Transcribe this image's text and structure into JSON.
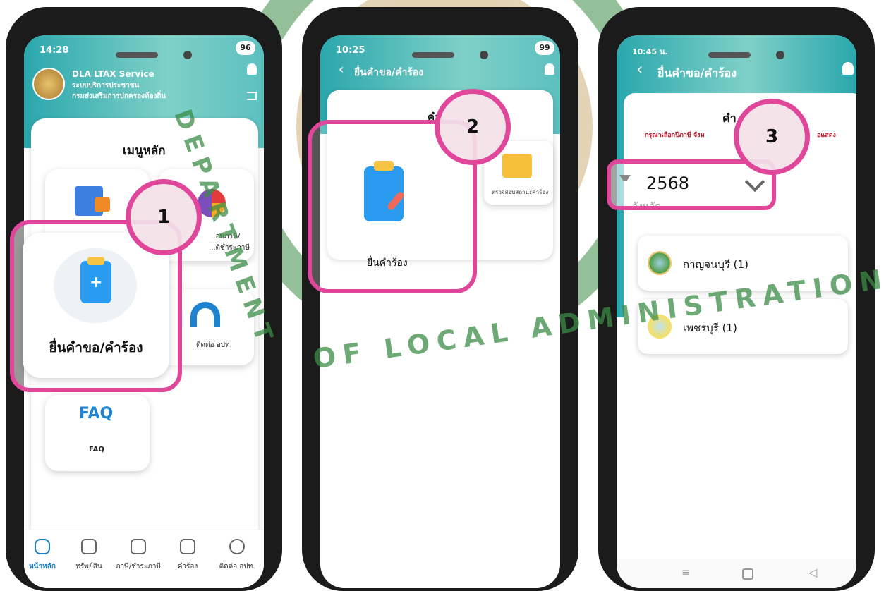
{
  "watermark": {
    "text_top": "DEPARTMENT",
    "text_bottom": "OF LOCAL ADMINISTRATION"
  },
  "phone1": {
    "status": {
      "time": "14:28",
      "battery": "96"
    },
    "header": {
      "title": "DLA LTAX Service",
      "line1": "ระบบบริการประชาชน",
      "line2": "กรมส่งเสริมการปกครองท้องถิ่น"
    },
    "menu_title": "เมนูหลัก",
    "tiles": {
      "tax_label_line1": "...อบภาษี/",
      "tax_label_line2": "...ติชำระภาษี",
      "contact_label": "ติดต่อ อปท.",
      "faq_label": "FAQ",
      "faq_art": "FAQ"
    },
    "highlight": {
      "label": "ยื่นคำขอ/คำร้อง"
    },
    "step": "1",
    "nav": [
      "หน้าหลัก",
      "ทรัพย์สิน",
      "ภาษี/ชำระภาษี",
      "คำร้อง",
      "ติดต่อ อปท."
    ]
  },
  "phone2": {
    "status": {
      "time": "10:25",
      "battery": "99"
    },
    "header": {
      "title": "ยื่นคำขอ/คำร้อง"
    },
    "card_heading": "คำ",
    "tiles": {
      "submit_label": "ยื่นคำร้อง",
      "check_label": "ตรวจสอบสถานะคำร้อง"
    },
    "step": "2"
  },
  "phone3": {
    "status": {
      "time": "10:45 น."
    },
    "header": {
      "title": "ยื่นคำขอ/คำร้อง"
    },
    "card_heading": "คำ",
    "instruction_left": "กรุณาเลือกปีภาษี จังห",
    "instruction_right": "อแสดง",
    "year_value": "2568",
    "province_label": "จังหวัด",
    "provinces": [
      {
        "name": "กาญจนบุรี (1)"
      },
      {
        "name": "เพชรบุรี (1)"
      }
    ],
    "step": "3"
  },
  "colors": {
    "accent_pink": "#e0469a",
    "header_teal": "#2aa7ad",
    "nav_active": "#1b80c4"
  }
}
